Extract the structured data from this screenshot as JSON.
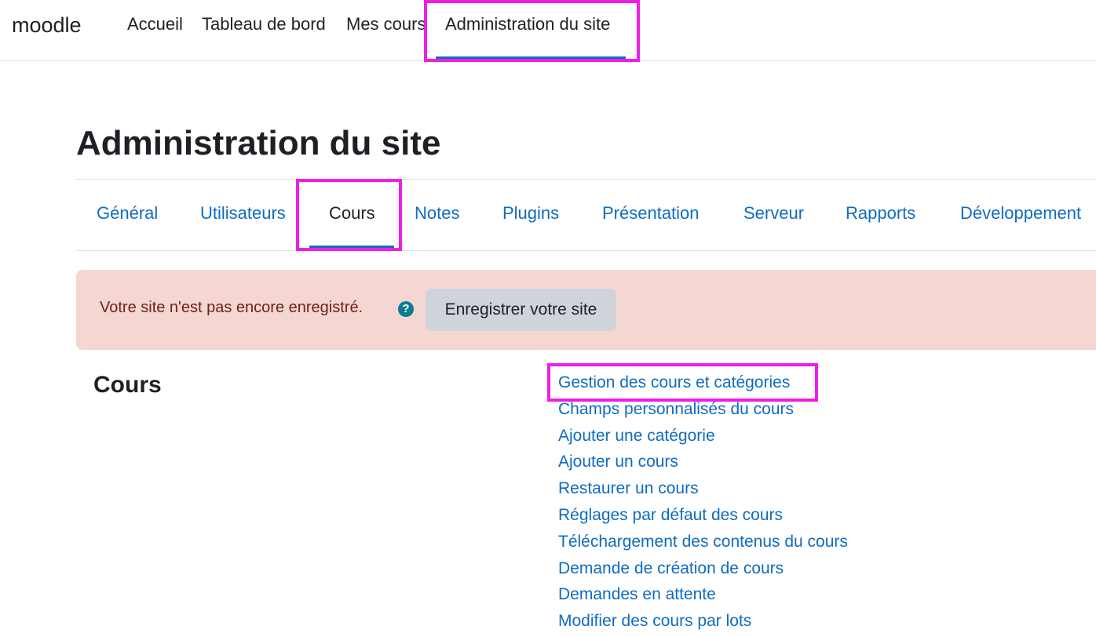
{
  "topnav": {
    "brand": "moodle",
    "items": [
      {
        "label": "Accueil"
      },
      {
        "label": "Tableau de bord"
      },
      {
        "label": "Mes cours"
      },
      {
        "label": "Administration du site"
      }
    ],
    "active_item": "Administration du site"
  },
  "page": {
    "title": "Administration du site"
  },
  "tabs": {
    "items": [
      {
        "label": "Général"
      },
      {
        "label": "Utilisateurs"
      },
      {
        "label": "Cours"
      },
      {
        "label": "Notes"
      },
      {
        "label": "Plugins"
      },
      {
        "label": "Présentation"
      },
      {
        "label": "Serveur"
      },
      {
        "label": "Rapports"
      },
      {
        "label": "Développement"
      }
    ],
    "active_tab": "Cours"
  },
  "alert": {
    "text": "Votre site n'est pas encore enregistré.",
    "help_icon": "question-circle-icon",
    "button_label": "Enregistrer votre site"
  },
  "section": {
    "title": "Cours",
    "links": [
      {
        "label": "Gestion des cours et catégories"
      },
      {
        "label": "Champs personnalisés du cours"
      },
      {
        "label": "Ajouter une catégorie"
      },
      {
        "label": "Ajouter un cours"
      },
      {
        "label": "Restaurer un cours"
      },
      {
        "label": "Réglages par défaut des cours"
      },
      {
        "label": "Téléchargement des contenus du cours"
      },
      {
        "label": "Demande de création de cours"
      },
      {
        "label": "Demandes en attente"
      },
      {
        "label": "Modifier des cours par lots"
      }
    ]
  },
  "colors": {
    "link": "#0f6cbf",
    "highlight": "#ee1ee6",
    "alert_background": "#f4d6d2",
    "alert_text": "#6e211a"
  }
}
